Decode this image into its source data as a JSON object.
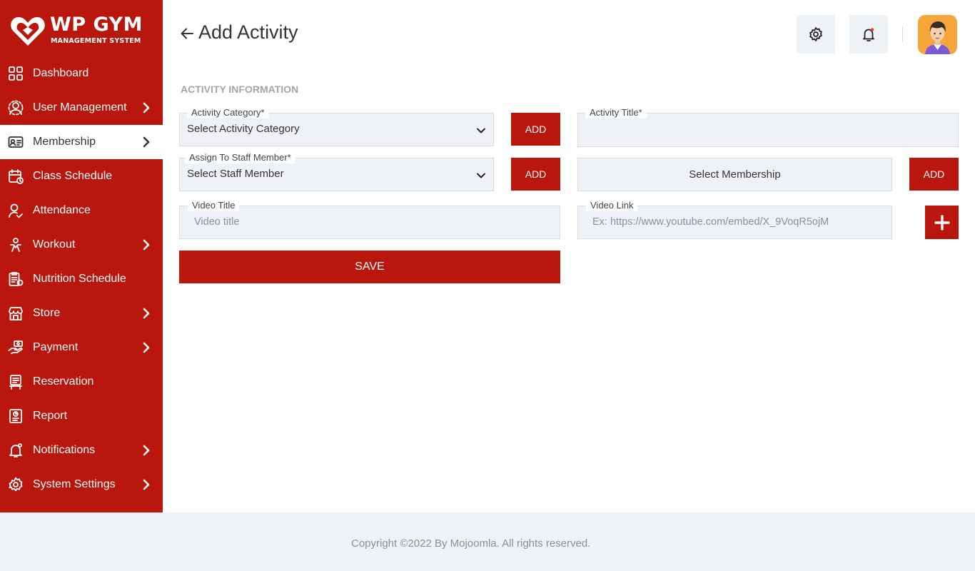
{
  "brand": {
    "title": "WP GYM",
    "subtitle": "MANAGEMENT SYSTEM"
  },
  "sidebar": {
    "items": [
      {
        "label": "Dashboard",
        "icon": "dashboard-grid-icon",
        "has_chevron": false
      },
      {
        "label": "User Management",
        "icon": "user-gear-icon",
        "has_chevron": true
      },
      {
        "label": "Membership",
        "icon": "membership-card-icon",
        "has_chevron": true,
        "active": true
      },
      {
        "label": "Class Schedule",
        "icon": "calendar-icon",
        "has_chevron": false
      },
      {
        "label": "Attendance",
        "icon": "user-check-icon",
        "has_chevron": false
      },
      {
        "label": "Workout",
        "icon": "workout-icon",
        "has_chevron": true
      },
      {
        "label": "Nutrition Schedule",
        "icon": "clipboard-icon",
        "has_chevron": false
      },
      {
        "label": "Store",
        "icon": "store-icon",
        "has_chevron": true
      },
      {
        "label": "Payment",
        "icon": "payment-hand-icon",
        "has_chevron": true
      },
      {
        "label": "Reservation",
        "icon": "reservation-icon",
        "has_chevron": false
      },
      {
        "label": "Report",
        "icon": "report-icon",
        "has_chevron": false
      },
      {
        "label": "Notifications",
        "icon": "bell-icon",
        "has_chevron": true
      },
      {
        "label": "System Settings",
        "icon": "gear-icon",
        "has_chevron": true
      }
    ]
  },
  "header": {
    "title": "Add Activity"
  },
  "form": {
    "section_title": "ACTIVITY INFORMATION",
    "activity_category": {
      "label": "Activity Category*",
      "value": "Select Activity Category"
    },
    "activity_title": {
      "label": "Activity Title*",
      "value": ""
    },
    "staff_member": {
      "label": "Assign To Staff Member*",
      "value": "Select Staff Member"
    },
    "membership": {
      "value": "Select Membership"
    },
    "video_title": {
      "label": "Video Title",
      "placeholder": "Video title"
    },
    "video_link": {
      "label": "Video Link",
      "placeholder": "Ex: https://www.youtube.com/embed/X_9VoqR5ojM"
    },
    "add_label": "ADD",
    "save_label": "SAVE"
  },
  "footer": {
    "text": "Copyright ©2022 By Mojoomla. All rights reserved."
  },
  "colors": {
    "brand_red": "#b9160d",
    "field_bg": "#eef2f7",
    "avatar_bg": "#f6a53a"
  }
}
